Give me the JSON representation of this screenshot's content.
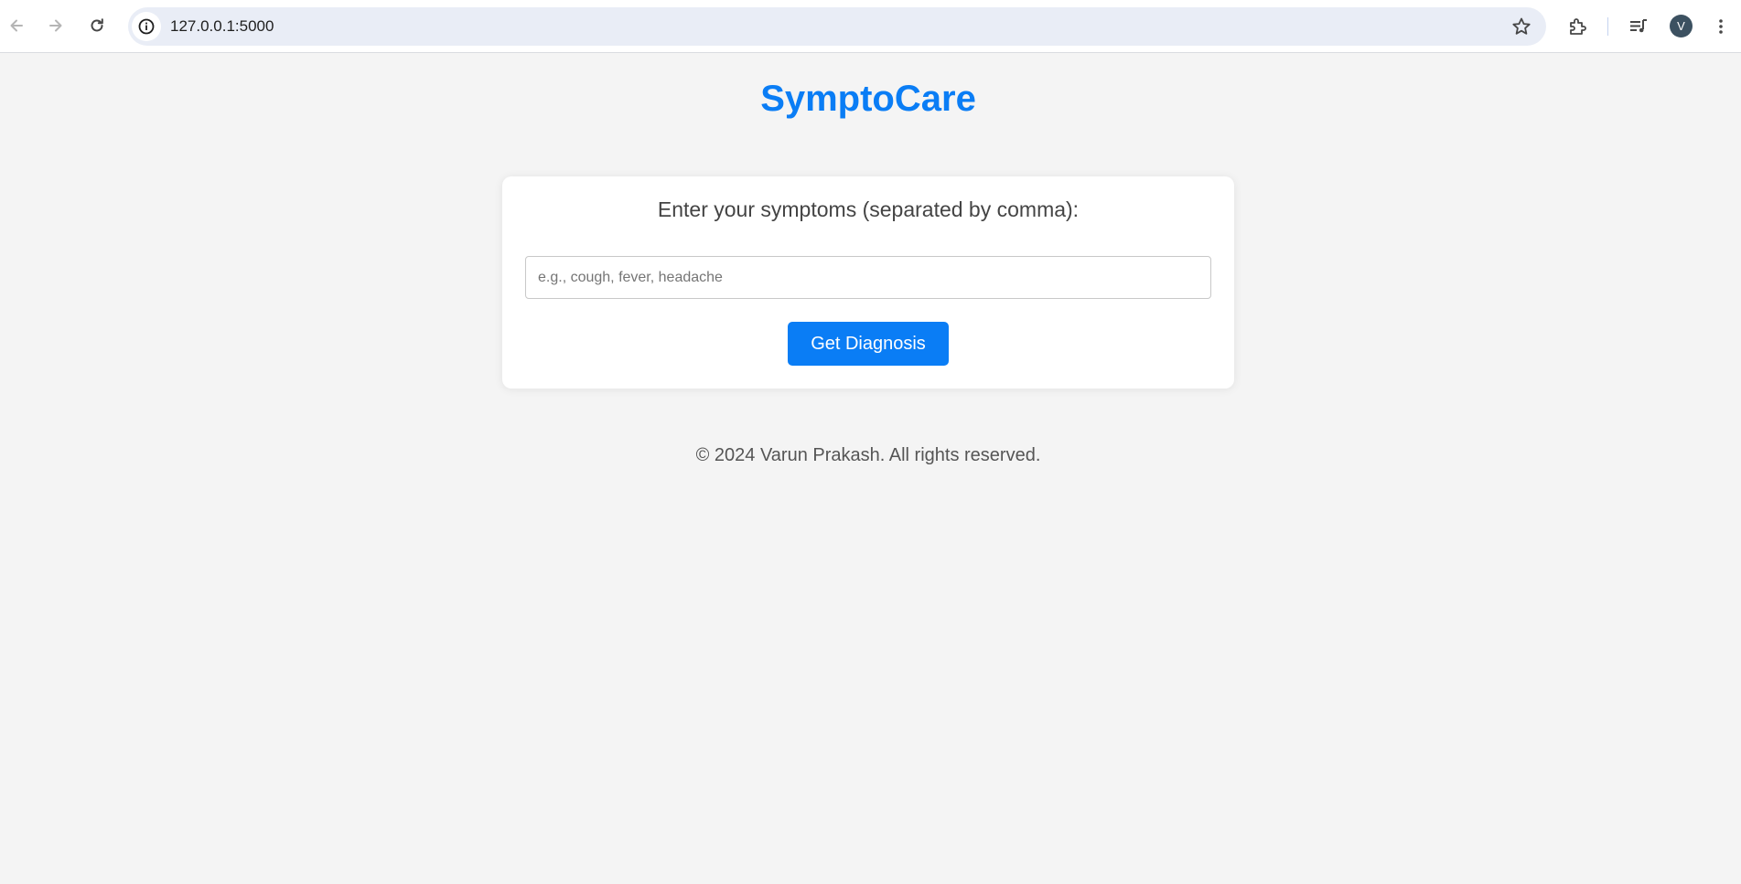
{
  "browser": {
    "url": "127.0.0.1:5000",
    "avatar_initial": "V"
  },
  "app": {
    "title": "SymptoCare"
  },
  "form": {
    "label": "Enter your symptoms (separated by comma):",
    "input_value": "",
    "input_placeholder": "e.g., cough, fever, headache",
    "submit_label": "Get Diagnosis"
  },
  "footer": {
    "text": "© 2024 Varun Prakash. All rights reserved."
  },
  "colors": {
    "accent": "#0a7df5",
    "page_background": "#f4f4f4",
    "card_background": "#ffffff"
  },
  "icons": {
    "back": "arrow-back-icon",
    "forward": "arrow-forward-icon",
    "reload": "reload-icon",
    "site_info": "info-icon",
    "bookmark": "star-icon",
    "extensions": "puzzle-icon",
    "media": "media-queue-icon",
    "menu": "kebab-menu-icon"
  }
}
